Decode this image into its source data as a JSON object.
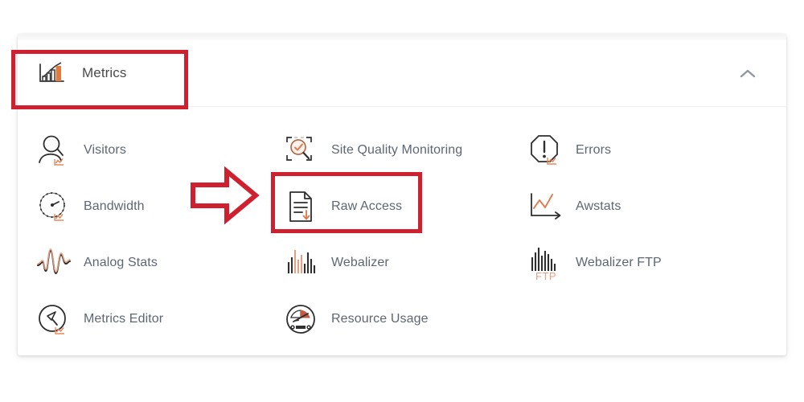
{
  "panel": {
    "title": "Metrics",
    "header_icon": "bar-chart-icon",
    "collapse_icon": "chevron-up-icon"
  },
  "columns": [
    {
      "id": "column-1",
      "items": [
        {
          "label": "Visitors",
          "icon": "visitor-person-chart-icon"
        },
        {
          "label": "Bandwidth",
          "icon": "gauge-chart-icon"
        },
        {
          "label": "Analog Stats",
          "icon": "waveform-icon"
        },
        {
          "label": "Metrics Editor",
          "icon": "circle-pen-chart-icon"
        }
      ]
    },
    {
      "id": "column-2",
      "items": [
        {
          "label": "Site Quality Monitoring",
          "icon": "magnifier-check-frame-icon"
        },
        {
          "label": "Raw Access",
          "icon": "document-download-icon"
        },
        {
          "label": "Webalizer",
          "icon": "bars-icon"
        },
        {
          "label": "Resource Usage",
          "icon": "dial-meter-icon"
        }
      ]
    },
    {
      "id": "column-3",
      "items": [
        {
          "label": "Errors",
          "icon": "octagon-exclamation-chart-icon"
        },
        {
          "label": "Awstats",
          "icon": "line-chart-axis-icon"
        },
        {
          "label": "Webalizer FTP",
          "icon": "bars-ftp-icon"
        },
        {
          "label": "",
          "icon": ""
        }
      ]
    }
  ],
  "annotations": [
    {
      "name": "metrics-header-highlight",
      "shape": "rectangle",
      "color": "#cf2030"
    },
    {
      "name": "raw-access-highlight",
      "shape": "rectangle",
      "color": "#cf2030"
    },
    {
      "name": "pointer-arrow-to-raw-access",
      "shape": "right-arrow",
      "color": "#cf2030"
    }
  ],
  "colors": {
    "accent_red": "#cf2030",
    "icon_orange": "#e07b4f",
    "label_gray": "#5d6773",
    "title_gray": "#4a4a4a",
    "card_bg": "#ffffff",
    "divider": "#eceef0"
  }
}
